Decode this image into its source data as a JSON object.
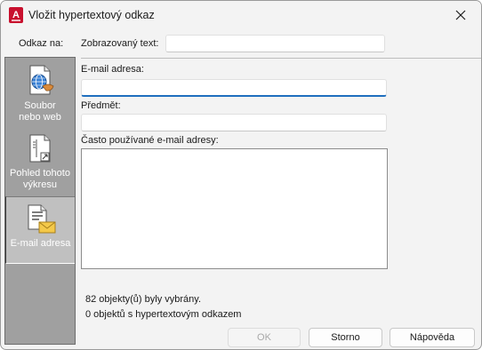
{
  "window": {
    "title": "Vložit hypertextový odkaz",
    "app_icon": "autocad-icon",
    "close_icon": "close-icon"
  },
  "link_to": {
    "label": "Odkaz na:",
    "items": [
      {
        "label_line1": "Soubor",
        "label_line2": "nebo web",
        "icon": "globe-document-icon",
        "active": false
      },
      {
        "label_line1": "Pohled tohoto",
        "label_line2": "výkresu",
        "icon": "drawing-view-icon",
        "active": false
      },
      {
        "label_line1": "E-mail adresa",
        "label_line2": "",
        "icon": "email-document-icon",
        "active": true
      }
    ]
  },
  "display_text": {
    "label": "Zobrazovaný text:",
    "value": ""
  },
  "email": {
    "label": "E-mail adresa:",
    "value": ""
  },
  "subject": {
    "label": "Předmět:",
    "value": ""
  },
  "recent": {
    "label": "Často používané e-mail adresy:",
    "items": []
  },
  "info": {
    "selected": "82 objekty(ů) byly vybrány.",
    "with_hyperlink": "0 objektů s hypertextovým odkazem"
  },
  "buttons": {
    "ok": "OK",
    "cancel": "Storno",
    "help": "Nápověda"
  },
  "colors": {
    "accent": "#1f6fbe",
    "sidebar": "#a0a0a0",
    "app_red": "#c8102e"
  }
}
